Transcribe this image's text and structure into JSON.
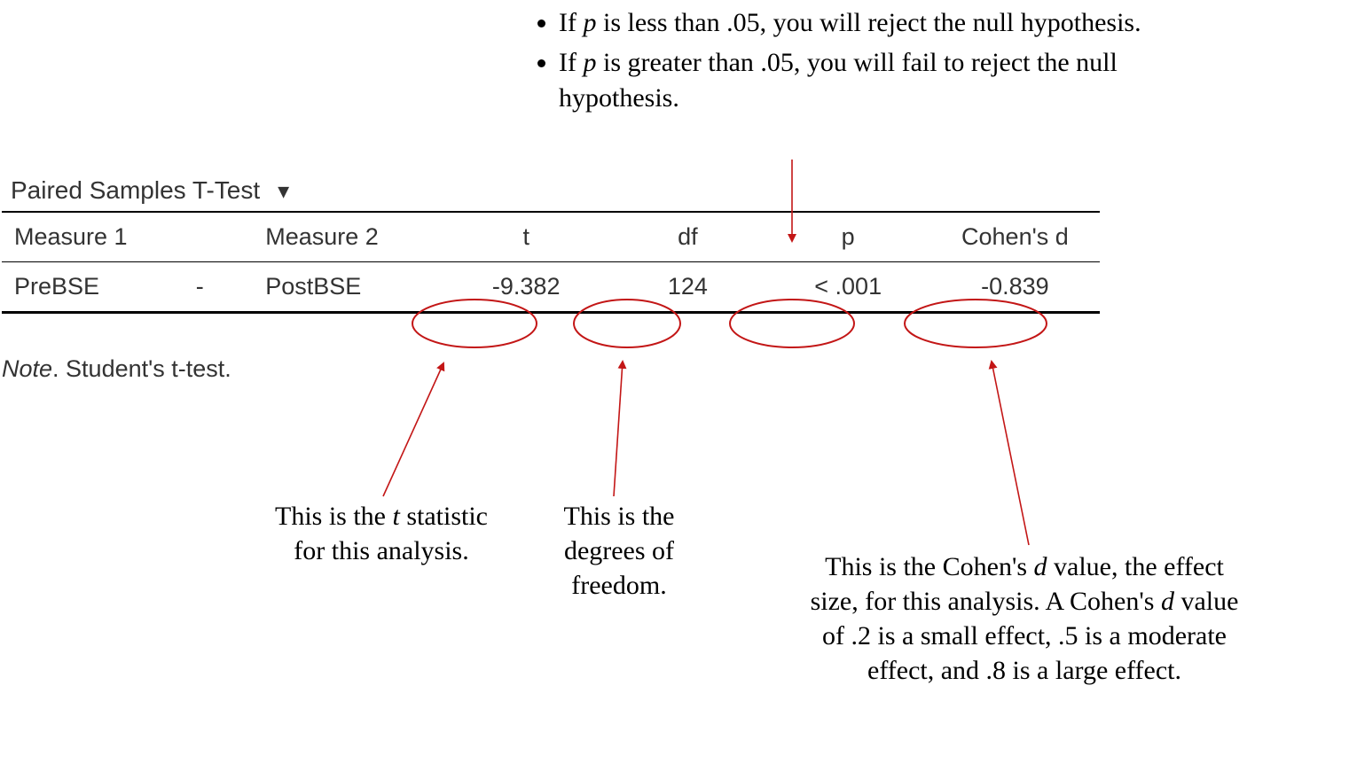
{
  "bullets": {
    "item1_prefix": "If ",
    "item1_var": "p",
    "item1_suffix": " is less than .05, you will reject the null hypothesis.",
    "item2_prefix": "If ",
    "item2_var": "p",
    "item2_suffix": " is greater than .05, you will fail to reject the null hypothesis."
  },
  "table": {
    "title": "Paired Samples T-Test",
    "headers": {
      "measure1": "Measure 1",
      "measure2": "Measure 2",
      "t": "t",
      "df": "df",
      "p": "p",
      "cohend": "Cohen's d"
    },
    "row": {
      "measure1": "PreBSE",
      "dash": "-",
      "measure2": "PostBSE",
      "t": "-9.382",
      "df": "124",
      "p": "< .001",
      "cohend": "-0.839"
    },
    "note_label": "Note",
    "note_text": ". Student's t-test."
  },
  "annotations": {
    "t_stat_1": "This is the ",
    "t_stat_var": "t",
    "t_stat_2": " statistic for this analysis.",
    "df_text": "This is the degrees of freedom.",
    "cohen_1": "This is the Cohen's ",
    "cohen_var1": "d",
    "cohen_2": " value, the effect size, for this analysis. A Cohen's ",
    "cohen_var2": "d",
    "cohen_3": " value of .2 is a small effect, .5 is a moderate effect, and .8 is a large effect."
  }
}
